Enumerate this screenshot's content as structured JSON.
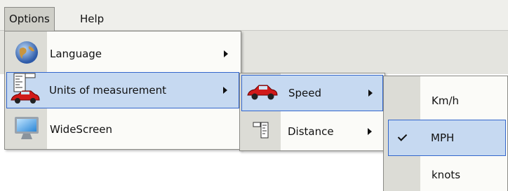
{
  "menubar": {
    "options_label": "Options",
    "help_label": "Help"
  },
  "options_menu": {
    "items": [
      {
        "label": "Language",
        "icon": "globe-icon",
        "has_submenu": true
      },
      {
        "label": "Units of measurement",
        "icon": "ruler-car-icon",
        "has_submenu": true,
        "highlighted": true
      },
      {
        "label": "WideScreen",
        "icon": "monitor-icon",
        "has_submenu": false
      }
    ]
  },
  "units_menu": {
    "items": [
      {
        "label": "Speed",
        "icon": "car-icon",
        "has_submenu": true,
        "highlighted": true
      },
      {
        "label": "Distance",
        "icon": "ruler-icon",
        "has_submenu": true
      }
    ]
  },
  "speed_menu": {
    "items": [
      {
        "label": "Km/h",
        "checked": false
      },
      {
        "label": "MPH",
        "checked": true,
        "highlighted": true
      },
      {
        "label": "knots",
        "checked": false
      }
    ]
  },
  "colors": {
    "highlight_fill": "#c6d9f1",
    "highlight_border": "#3366cc",
    "gutter": "#dcdcd6"
  }
}
